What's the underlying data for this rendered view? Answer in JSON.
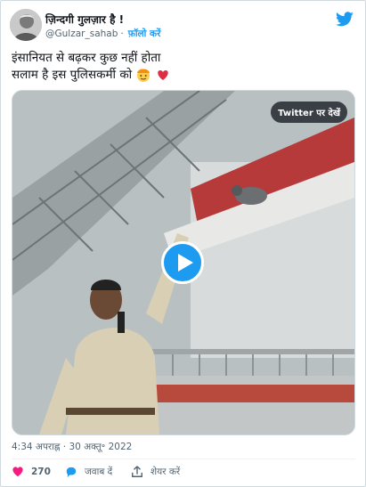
{
  "author": {
    "display_name": "ज़िन्दगी गुलज़ार है !",
    "handle": "@Gulzar_sahab",
    "separator": "·",
    "follow_label": "फ़ॉलो करें"
  },
  "tweet": {
    "line1": "इंसानियत से बढ़कर कुछ नहीं होता",
    "line2": "सलाम है इस पुलिसकर्मी को"
  },
  "media": {
    "watch_label": "Twitter पर देखें"
  },
  "timestamp": "4:34 अपराह्न · 30 अक्तू॰ 2022",
  "actions": {
    "like_count": "270",
    "reply_label": "जवाब दें",
    "share_label": "शेयर करें"
  },
  "colors": {
    "accent": "#1d9bf0",
    "like": "#f91880",
    "text": "#0f1419",
    "muted": "#536471"
  }
}
